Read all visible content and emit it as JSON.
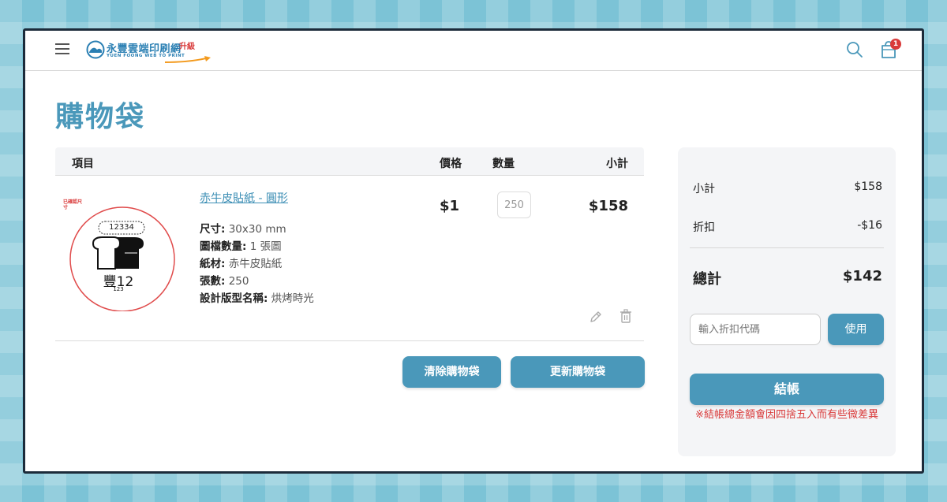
{
  "header": {
    "logo_text": "永豐雲端印刷網",
    "logo_subtext": "YUEN FOONG WEB TO PRINT",
    "logo_tag": "升級",
    "cart_count": "1"
  },
  "page": {
    "title": "購物袋"
  },
  "table": {
    "col_item": "項目",
    "col_price": "價格",
    "col_qty": "數量",
    "col_subtotal": "小計"
  },
  "item": {
    "name": "赤牛皮貼紙 - 圓形",
    "specs": [
      {
        "label": "尺寸:",
        "value": "30x30 mm"
      },
      {
        "label": "圖檔數量:",
        "value": "1 張圖"
      },
      {
        "label": "紙材:",
        "value": "赤牛皮貼紙"
      },
      {
        "label": "張數:",
        "value": "250"
      },
      {
        "label": "設計版型名稱:",
        "value": "烘烤時光"
      }
    ],
    "price": "$1",
    "qty": "250",
    "subtotal": "$158",
    "thumb": {
      "stamp_text": "已確認尺寸",
      "code": "12334",
      "brand": "豐12",
      "small": "123"
    }
  },
  "actions": {
    "clear_label": "清除購物袋",
    "update_label": "更新購物袋"
  },
  "summary": {
    "subtotal_label": "小計",
    "subtotal_value": "$158",
    "discount_label": "折扣",
    "discount_value": "-$16",
    "total_label": "總計",
    "total_value": "$142",
    "coupon_placeholder": "輸入折扣代碼",
    "apply_label": "使用",
    "checkout_label": "結帳",
    "note": "※結帳總金額會因四捨五入而有些微差異"
  },
  "colors": {
    "accent": "#4a98ba",
    "warning": "#d93a3a",
    "background": "#7cc3d6"
  }
}
